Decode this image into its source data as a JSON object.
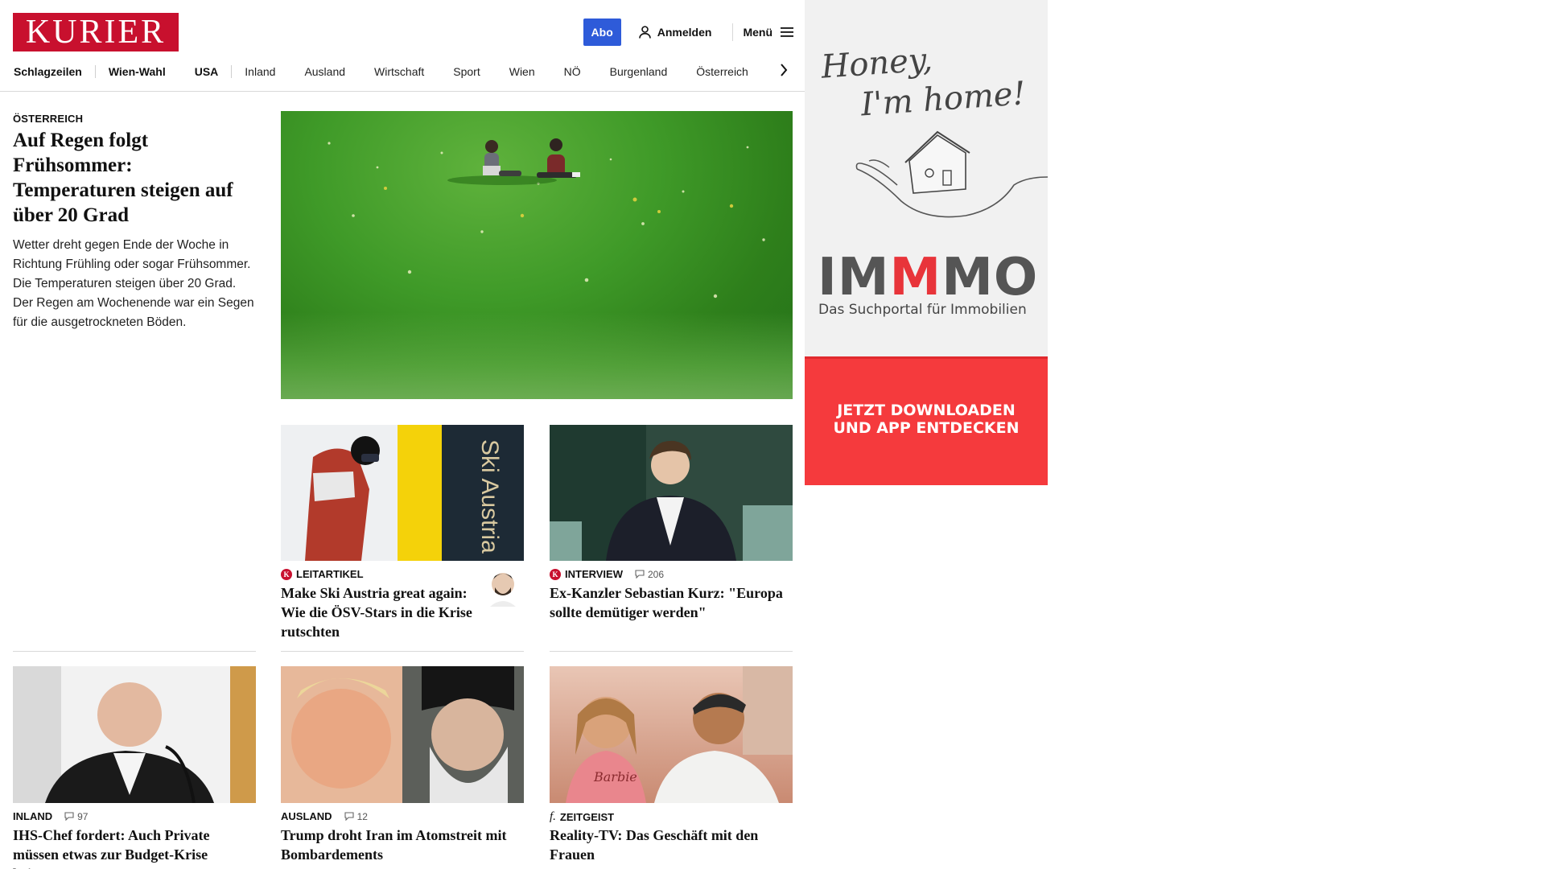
{
  "header": {
    "logo": "KURIER",
    "abo_label": "Abo",
    "login_label": "Anmelden",
    "menu_label": "Menü"
  },
  "nav": {
    "items": [
      "Schlagzeilen",
      "Wien-Wahl",
      "USA",
      "Inland",
      "Ausland",
      "Wirtschaft",
      "Sport",
      "Wien",
      "NÖ",
      "Burgenland",
      "Österreich"
    ]
  },
  "lead": {
    "kicker": "ÖSTERREICH",
    "title": "Auf Regen folgt Frühsommer: Temperaturen steigen auf über 20 Grad",
    "teaser": "Wetter dreht gegen Ende der Woche in Richtung Frühling oder sogar Frühsommer. Die Temperaturen steigen über 20 Grad. Der Regen am Wochenende war ein Segen für die ausgetrockneten Böden."
  },
  "cards": [
    {
      "kicker": "LEITARTIKEL",
      "badge": "K",
      "comments": "",
      "title": "Make Ski Austria great again: Wie die ÖSV-Stars in die Krise rutschten",
      "image_text": "Ski Austria"
    },
    {
      "kicker": "INTERVIEW",
      "badge": "K",
      "comments": "206",
      "title": "Ex-Kanzler Sebastian Kurz: \"Europa sollte demütiger werden\""
    },
    {
      "kicker": "INLAND",
      "badge": "",
      "comments": "97",
      "title": "IHS-Chef fordert: Auch Private müssen etwas zur Budget-Krise beitragen"
    },
    {
      "kicker": "AUSLAND",
      "badge": "",
      "comments": "12",
      "title": "Trump droht Iran im Atomstreit mit Bombardements"
    },
    {
      "kicker": "ZEITGEIST",
      "badge": "f.",
      "comments": "",
      "title": "Reality-TV: Das Geschäft mit den Frauen",
      "shirt_text": "Barbie"
    }
  ],
  "ad": {
    "tagline_1": "Honey,",
    "tagline_2": "I'm home!",
    "brand_a": "IM",
    "brand_b": "M",
    "brand_c": "MO",
    "subtitle": "Das Suchportal für Immobilien",
    "cta_1": "JETZT DOWNLOADEN",
    "cta_2": "UND APP ENTDECKEN",
    "colors": {
      "cta_bg": "#f53a3d",
      "brand_accent": "#e8343a"
    }
  },
  "colors": {
    "brand_red": "#c8102e",
    "abo_blue": "#2e5bd9"
  }
}
